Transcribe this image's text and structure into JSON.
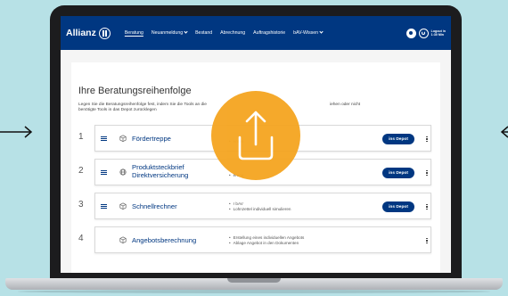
{
  "nav": {
    "brand": "Allianz",
    "items": [
      {
        "label": "Beratung",
        "active": true,
        "dropdown": false
      },
      {
        "label": "Neuanmeldung",
        "active": false,
        "dropdown": true
      },
      {
        "label": "Bestand",
        "active": false,
        "dropdown": false
      },
      {
        "label": "Abrechnung",
        "active": false,
        "dropdown": false
      },
      {
        "label": "Auftragshistorie",
        "active": false,
        "dropdown": false
      },
      {
        "label": "bAV-Wissen",
        "active": false,
        "dropdown": true
      }
    ],
    "login_line1": "Logout in",
    "login_line2": "1:30 Min"
  },
  "page": {
    "title": "Ihre Beratungsreihenfolge",
    "desc_line1": "Legen Sie die Beratungsreihenfolge fest, indem Sie die Tools an die",
    "desc_line2": "benötigte Tools in das Depot zurücklegen",
    "desc_line1_tail": "iehen oder nicht"
  },
  "rows": [
    {
      "num": "1",
      "name_line1": "Fördertreppe",
      "name_line2": "",
      "icon": "cube-icon",
      "bullet1": "",
      "bullet2": "enten",
      "button": "ins Depot"
    },
    {
      "num": "2",
      "name_line1": "Produktsteckbrief",
      "name_line2": "Direktversicherung",
      "icon": "globe-icon",
      "bullet1": "",
      "bullet2": "erung",
      "button": "ins Depot"
    },
    {
      "num": "3",
      "name_line1": "Schnellrechner",
      "name_line2": "",
      "icon": "cube-icon",
      "bullet1": "r bAV",
      "bullet2": "Lohnzettel individuell simulieren",
      "button": "ins Depot"
    },
    {
      "num": "4",
      "name_line1": "Angebotsberechnung",
      "name_line2": "",
      "icon": "cube-icon",
      "bullet1": "Erstellung eines individuellen Angebots",
      "bullet2": "Ablage Angebot in den Dokumenten",
      "button": ""
    }
  ],
  "overlay": {
    "icon": "upload-icon",
    "color": "#f5a623"
  },
  "colors": {
    "primary": "#003781",
    "background": "#b7e1e6",
    "accent": "#f5a623"
  }
}
